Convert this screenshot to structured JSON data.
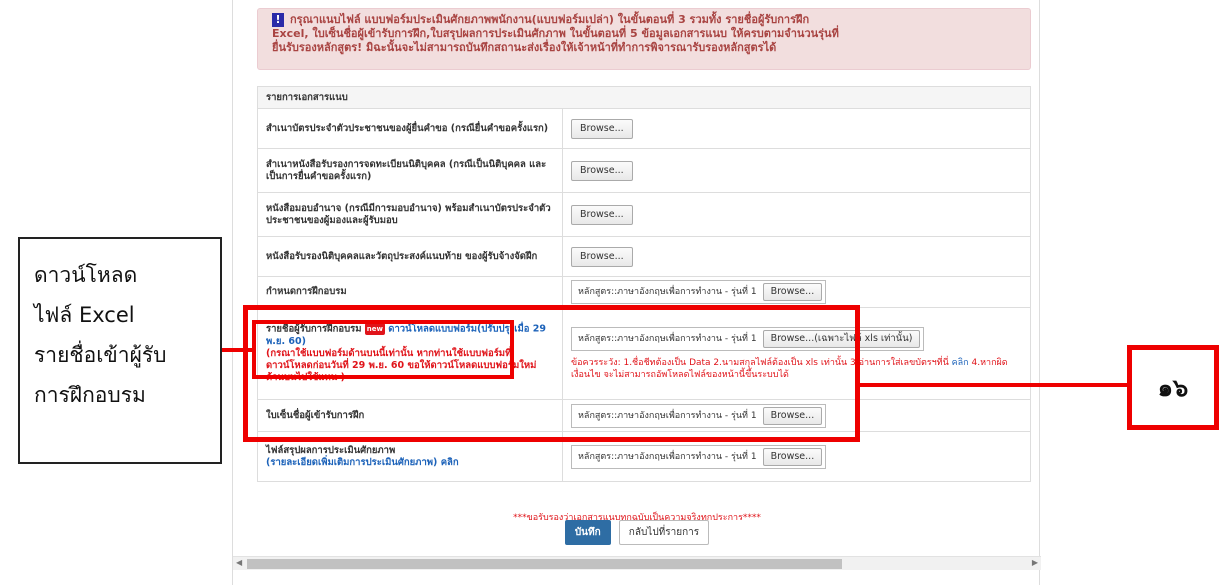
{
  "alert": {
    "icon": "exclamation-icon",
    "text_line1": "กรุณาแนบไฟล์ แบบฟอร์มประเมินศักยภาพพนักงาน(แบบฟอร์มเปล่า) ในขั้นตอนที่ 3 รวมทั้ง รายชื่อผู้รับการฝึก",
    "text_line2": "Excel, ใบเซ็นชื่อผู้เข้ารับการฝึก,ใบสรุปผลการประเมินศักภาพ ในขั้นตอนที่ 5 ข้อมูลเอกสารแนบ ให้ครบตามจำนวนรุ่นที่",
    "text_line3": "ยื่นรับรองหลักสูตร! มิฉะนั้นจะไม่สามารถบันทึกสถานะส่งเรื่องให้เจ้าหน้าที่ทำการพิจารณารับรองหลักสูตรได้"
  },
  "table": {
    "header": "รายการเอกสารแนบ",
    "rows": [
      {
        "label": "สำเนาบัตรประจำตัวประชาชนของผู้ยื่นคำขอ (กรณียื่นคำขอครั้งแรก)",
        "button": "Browse..."
      },
      {
        "label": "สำเนาหนังสือรับรองการจดทะเบียนนิติบุคคล (กรณีเป็นนิติบุคคล และเป็นการยื่นคำขอครั้งแรก)",
        "button": "Browse..."
      },
      {
        "label": "หนังสือมอบอำนาจ (กรณีมีการมอบอำนาจ) พร้อมสำเนาบัตรประจำตัวประชาชนของผู้มองและผู้รับมอบ",
        "button": "Browse..."
      },
      {
        "label": "หนังสือรับรองนิติบุคคลและวัตถุประสงค์แนบท้าย ของผู้รับจ้างจัดฝึก",
        "button": "Browse..."
      }
    ],
    "schedule": {
      "label": "กำหนดการฝึกอบรม",
      "file_text": "หลักสูตร::ภาษาอังกฤษเพื่อการทำงาน - รุ่นที่ 1",
      "button": "Browse..."
    },
    "trainees": {
      "label": "รายชื่อผู้รับการฝึกอบรม",
      "badge": "new",
      "link": "ดาวน์โหลดแบบฟอร์ม(ปรับปรุงเมื่อ 29 พ.ย. 60)",
      "note": "(กรณาใช้แบบฟอร์มด้านบนนี้เท่านั้น หากท่านใช้แบบฟอร์มที่ดาวน์โหลดก่อนวันที่ 29 พ.ย. 60 ขอให้ดาวน์โหลดแบบฟอร์มใหม่ด้านบนไปใช้แทน )",
      "file_text": "หลักสูตร::ภาษาอังกฤษเพื่อการทำงาน - รุ่นที่ 1",
      "button": "Browse...(เฉพาะไฟล์ xls เท่านั้น)",
      "warning": "ข้อควรระวัง: 1.ชื่อชีทต้องเป็น Data 2.นามสกุลไฟล์ต้องเป็น xls เท่านั้น 3.อ่านการใส่เลขบัตรฯที่นี่",
      "warning_link": "คลิก",
      "warning2": "4.หากผิดเงื่อนไข จะไม่สามารถอัพโหลดไฟล์ของหน้านี้ขึ้นระบบได้"
    },
    "signin": {
      "label": "ใบเซ็นชื่อผู้เข้ารับการฝึก",
      "file_text": "หลักสูตร::ภาษาอังกฤษเพื่อการทำงาน - รุ่นที่ 1",
      "button": "Browse..."
    },
    "summary": {
      "label": "ไฟล์สรุปผลการประเมินศักยภาพ",
      "sub": "(รายละเอียดเพิ่มเติมการประเมินศักยภาพ)",
      "link": "คลิก",
      "file_text": "หลักสูตร::ภาษาอังกฤษเพื่อการทำงาน - รุ่นที่ 1",
      "button": "Browse..."
    }
  },
  "footer_note": "***ขอรับรองว่าเอกสารแนบทุกฉบับเป็นความจริงทุกประการ****",
  "actions": {
    "save": "บันทึก",
    "back": "กลับไปที่รายการ"
  },
  "callout": {
    "line1": "ดาวน์โหลด",
    "line2": "ไฟล์ Excel",
    "line3": "รายชื่อเข้าผู้รับ",
    "line4": "การฝึกอบรม"
  },
  "step_number": "๑๖",
  "colors": {
    "annotation_red": "#e00000",
    "alert_bg": "#f2dede",
    "primary": "#2e6da4"
  }
}
